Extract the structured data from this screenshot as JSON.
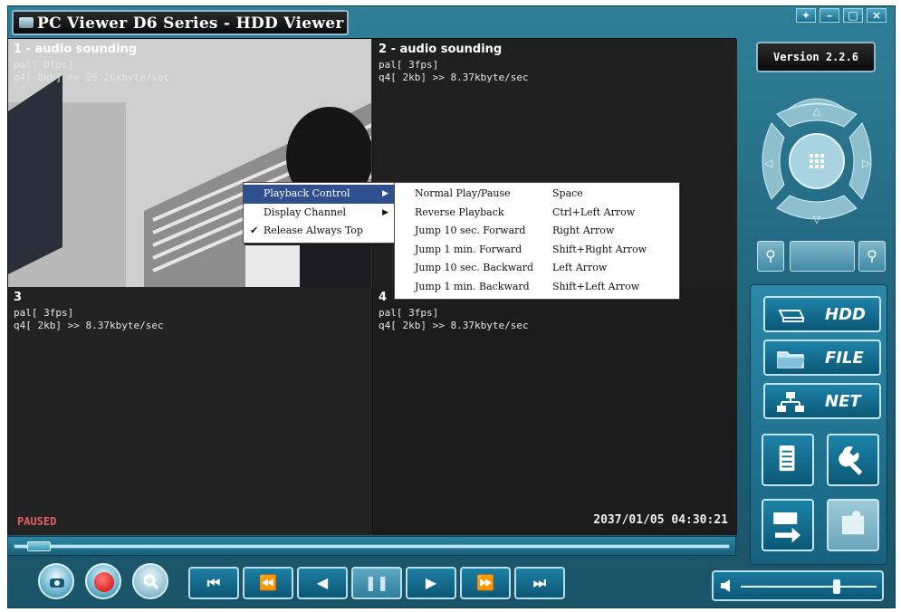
{
  "window": {
    "title": "PC Viewer D6 Series - HDD Viewer",
    "buttons": [
      "pin-icon",
      "minimize-icon",
      "maximize-icon",
      "close-icon"
    ]
  },
  "version": "Version 2.2.6",
  "cameras": [
    {
      "title": "1 - audio sounding",
      "fps": "pal[ 0fps]",
      "rate": "q4[ 8kb] >> 25.26kbyte/sec"
    },
    {
      "title": "2 - audio sounding",
      "fps": "pal[ 3fps]",
      "rate": "q4[ 2kb] >> 8.37kbyte/sec"
    },
    {
      "title": "3",
      "fps": "pal[ 3fps]",
      "rate": "q4[ 2kb] >> 8.37kbyte/sec"
    },
    {
      "title": "4",
      "fps": "pal[ 3fps]",
      "rate": "q4[ 2kb] >> 8.37kbyte/sec"
    }
  ],
  "status": {
    "paused": "PAUSED",
    "datetime": "2037/01/05 04:30:21"
  },
  "context_menu": {
    "items": [
      {
        "label": "Playback Control",
        "selected": true,
        "has_submenu": true
      },
      {
        "label": "Display Channel",
        "selected": false,
        "has_submenu": true
      },
      {
        "label": "Release Always Top",
        "selected": false,
        "checked": true
      }
    ],
    "submenu": [
      {
        "action": "Normal Play/Pause",
        "key": "Space"
      },
      {
        "action": "Reverse Playback",
        "key": "Ctrl+Left Arrow"
      },
      {
        "action": "Jump 10 sec. Forward",
        "key": "Right Arrow"
      },
      {
        "action": "Jump 1 min. Forward",
        "key": "Shift+Right Arrow"
      },
      {
        "action": "Jump 10 sec. Backward",
        "key": "Left Arrow"
      },
      {
        "action": "Jump 1 min. Backward",
        "key": "Shift+Left Arrow"
      }
    ]
  },
  "modes": {
    "hdd": "HDD",
    "file": "FILE",
    "net": "NET"
  },
  "timeline_progress": 0.02,
  "volume_level": 0.72,
  "colors": {
    "accent": "#1d7fa3",
    "panel": "#2f7f98",
    "menu_highlight": "#2f4f8f",
    "paused": "#e06060"
  }
}
